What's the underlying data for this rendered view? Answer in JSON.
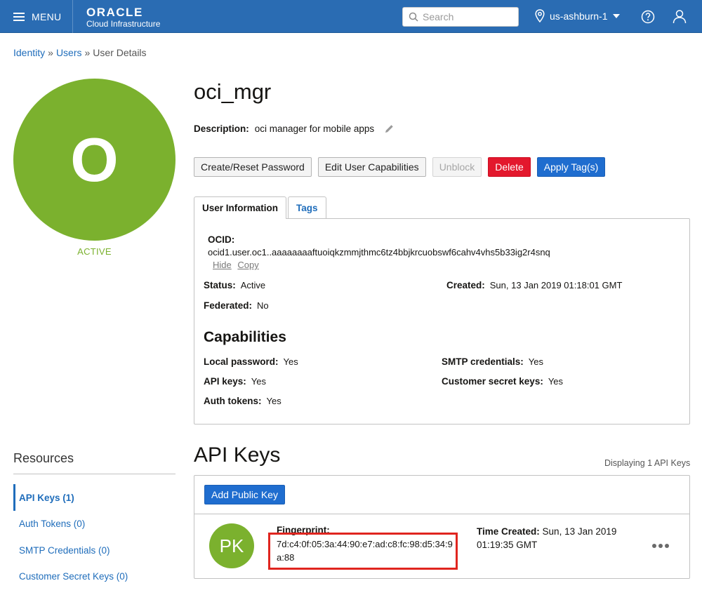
{
  "topbar": {
    "menu_label": "MENU",
    "logo_main": "ORACLE",
    "logo_sub": "Cloud Infrastructure",
    "search_placeholder": "Search",
    "region": "us-ashburn-1"
  },
  "breadcrumb": {
    "items": [
      "Identity",
      "Users",
      "User Details"
    ],
    "separator": "»"
  },
  "user": {
    "avatar_letter": "O",
    "status": "ACTIVE",
    "name": "oci_mgr",
    "description_label": "Description:",
    "description": "oci manager for mobile apps"
  },
  "actions": {
    "create_reset_password": "Create/Reset Password",
    "edit_capabilities": "Edit User Capabilities",
    "unblock": "Unblock",
    "delete": "Delete",
    "apply_tags": "Apply Tag(s)"
  },
  "tabs": [
    {
      "label": "User Information",
      "active": true
    },
    {
      "label": "Tags",
      "active": false
    }
  ],
  "info": {
    "ocid_label": "OCID:",
    "ocid": "ocid1.user.oc1..aaaaaaaaftuoiqkzmmjthmc6tz4bbjkrcuobswf6cahv4vhs5b33ig2r4snq",
    "hide": "Hide",
    "copy": "Copy",
    "status_label": "Status:",
    "status": "Active",
    "created_label": "Created:",
    "created": "Sun, 13 Jan 2019 01:18:01 GMT",
    "federated_label": "Federated:",
    "federated": "No"
  },
  "capabilities": {
    "title": "Capabilities",
    "local_password_label": "Local password:",
    "local_password": "Yes",
    "smtp_label": "SMTP credentials:",
    "smtp": "Yes",
    "api_keys_label": "API keys:",
    "api_keys": "Yes",
    "customer_secret_label": "Customer secret keys:",
    "customer_secret": "Yes",
    "auth_tokens_label": "Auth tokens:",
    "auth_tokens": "Yes"
  },
  "resources": {
    "title": "Resources",
    "items": [
      {
        "label": "API Keys (1)",
        "active": true
      },
      {
        "label": "Auth Tokens (0)",
        "active": false
      },
      {
        "label": "SMTP Credentials (0)",
        "active": false
      },
      {
        "label": "Customer Secret Keys (0)",
        "active": false
      }
    ]
  },
  "api_keys": {
    "title": "API Keys",
    "displaying": "Displaying 1 API Keys",
    "add_button": "Add Public Key",
    "row": {
      "avatar": "PK",
      "fingerprint_label": "Fingerprint:",
      "fingerprint": "7d:c4:0f:05:3a:44:90:e7:ad:c8:fc:98:d5:34:9a:88",
      "time_created_label": "Time Created:",
      "time_created": "Sun, 13 Jan 2019 01:19:35 GMT"
    }
  },
  "colors": {
    "topbar": "#2a6cb3",
    "active_green": "#7bb12e",
    "link_blue": "#1f6dbb",
    "danger": "#e3182d",
    "highlight": "#e0251f"
  }
}
